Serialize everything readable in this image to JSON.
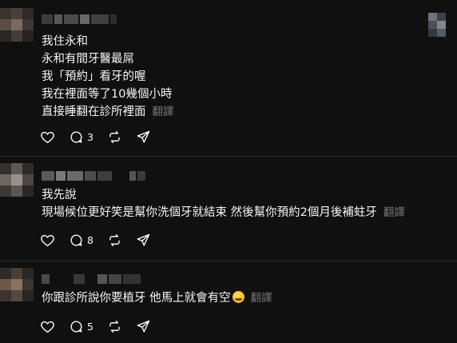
{
  "posts": [
    {
      "lines": [
        "我住永和",
        "永和有間牙醫最屌",
        "我「預約」看牙的喔",
        "我在裡面等了10幾個小時",
        "直接睡翻在診所裡面"
      ],
      "translate_label": "翻譯",
      "reply_count": "3",
      "icons": [
        "heart-icon",
        "comment-icon",
        "repost-icon",
        "share-icon"
      ]
    },
    {
      "lines": [
        "我先說",
        "現場候位更好笑是幫你洗個牙就結束 然後幫你預約2個月後補蛀牙"
      ],
      "translate_label": "翻譯",
      "reply_count": "8",
      "icons": [
        "heart-icon",
        "comment-icon",
        "repost-icon",
        "share-icon"
      ]
    },
    {
      "lines": [
        "你跟診所說你要植牙 他馬上就會有空"
      ],
      "emoji": "grinning-face-emoji",
      "translate_label": "翻譯",
      "reply_count": "5",
      "icons": [
        "heart-icon",
        "comment-icon",
        "repost-icon",
        "share-icon"
      ]
    }
  ],
  "colors": {
    "background": "#101010",
    "text": "#f3f5f7",
    "muted": "#777777",
    "divider": "#2a2a2a"
  }
}
